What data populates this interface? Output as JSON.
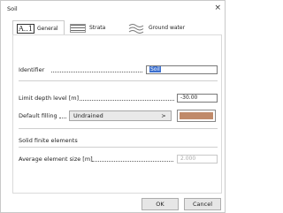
{
  "window": {
    "title": "Soil",
    "close_glyph": "×"
  },
  "tabs": [
    {
      "id": "general",
      "label": "General",
      "icon_text": "A..1",
      "icon": "a1-text-icon",
      "active": true
    },
    {
      "id": "strata",
      "label": "Strata",
      "icon": "strata-icon",
      "active": false
    },
    {
      "id": "ground_water",
      "label": "Ground water",
      "icon": "wave-icon",
      "active": false
    }
  ],
  "general": {
    "identifier_label": "Identifier",
    "identifier_value": "Soil",
    "limit_depth_label": "Limit depth level [m]",
    "limit_depth_value": "-30.00",
    "default_filling_label": "Default filling",
    "default_filling_value": "Undrained",
    "default_filling_arrow": ">",
    "default_filling_color": "#c08a6a",
    "section_title": "Solid finite elements",
    "avg_element_size_label": "Average element size [m]",
    "avg_element_size_value": "2.000"
  },
  "buttons": {
    "ok": "OK",
    "cancel": "Cancel"
  }
}
